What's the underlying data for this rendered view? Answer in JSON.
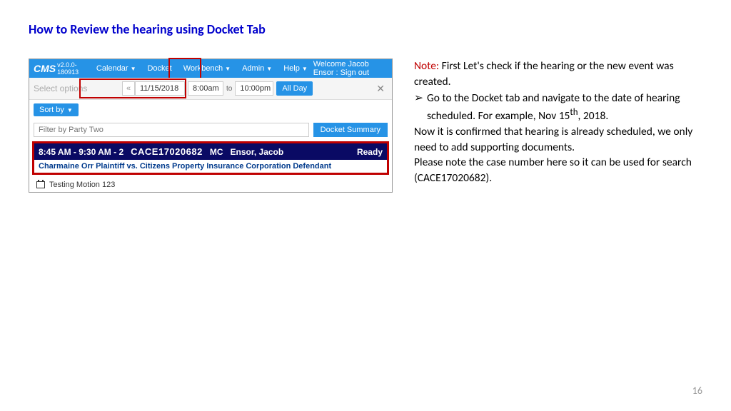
{
  "title": "How to Review the hearing using Docket Tab",
  "page_number": "16",
  "panel": {
    "brand": "CMS",
    "version": "v2.0.0-180913",
    "nav": {
      "calendar": "Calendar",
      "docket": "Docket",
      "workbench": "Workbench",
      "admin": "Admin",
      "help": "Help"
    },
    "welcome": "Welcome Jacob Ensor : Sign out",
    "select_options": "Select options",
    "left_arrow": "«",
    "date": "11/15/2018",
    "time_from": "8:00am",
    "to_label": "to",
    "time_to": "10:00pm",
    "all_day": "All Day",
    "sort_by": "Sort by",
    "filter_placeholder": "Filter by Party Two",
    "docket_summary": "Docket Summary",
    "entry": {
      "time": "8:45 AM - 9:30 AM - 2",
      "case_no": "CACE17020682",
      "mc": "MC",
      "judge": "Ensor, Jacob",
      "status": "Ready",
      "parties": "Charmaine Orr Plaintiff vs. Citizens Property Insurance Corporation Defendant"
    },
    "motion": "Testing Motion 123"
  },
  "notes": {
    "note_label": "Note:",
    "line1": " First Let's check if the hearing or the new event was created.",
    "bullet_a": "Go to the Docket tab and navigate to the date of hearing scheduled. For example, Nov 15",
    "bullet_sup": "th",
    "bullet_b": ", 2018.",
    "line2": "Now it is confirmed that hearing is already scheduled, we only need to add supporting documents.",
    "line3": "Please note the case number here so it can be used for search (CACE17020682)."
  }
}
